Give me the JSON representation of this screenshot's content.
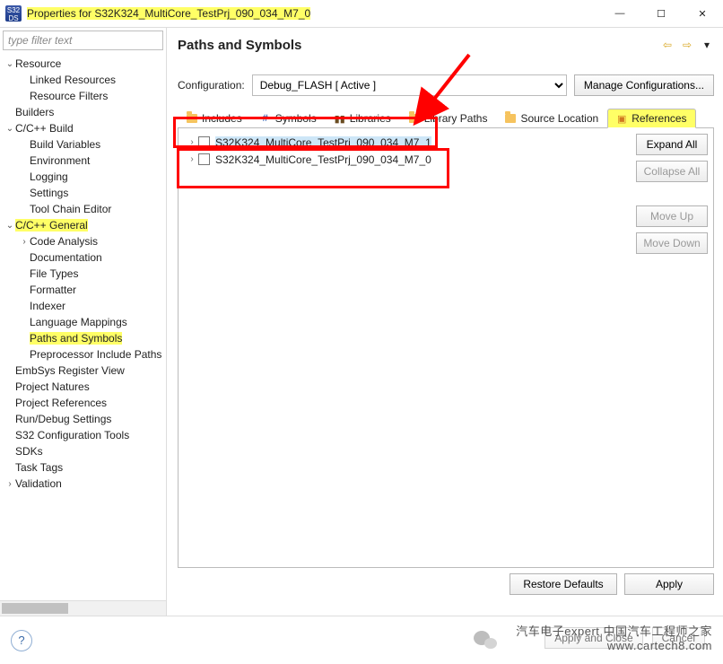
{
  "window": {
    "title": "Properties for S32K324_MultiCore_TestPrj_090_034_M7_0",
    "minimize": "—",
    "maximize": "☐",
    "close": "✕"
  },
  "filter_placeholder": "type filter text",
  "tree": {
    "resource": "Resource",
    "linked_resources": "Linked Resources",
    "resource_filters": "Resource Filters",
    "builders": "Builders",
    "c_build": "C/C++ Build",
    "build_variables": "Build Variables",
    "environment": "Environment",
    "logging": "Logging",
    "settings": "Settings",
    "tool_chain_editor": "Tool Chain Editor",
    "c_general": "C/C++ General",
    "code_analysis": "Code Analysis",
    "documentation": "Documentation",
    "file_types": "File Types",
    "formatter": "Formatter",
    "indexer": "Indexer",
    "language_mappings": "Language Mappings",
    "paths_and_symbols": "Paths and Symbols",
    "preprocessor_include_paths": "Preprocessor Include Paths",
    "embsys": "EmbSys Register View",
    "project_natures": "Project Natures",
    "project_references": "Project References",
    "run_debug": "Run/Debug Settings",
    "s32_config": "S32 Configuration Tools",
    "sdks": "SDKs",
    "task_tags": "Task Tags",
    "validation": "Validation"
  },
  "page": {
    "title": "Paths and Symbols",
    "config_label": "Configuration:",
    "config_value": "Debug_FLASH  [ Active ]",
    "manage_btn": "Manage Configurations..."
  },
  "tabs": {
    "includes": "Includes",
    "symbols": "Symbols",
    "libraries": "Libraries",
    "library_paths": "Library Paths",
    "source_location": "Source Location",
    "references": "References"
  },
  "refs": {
    "items": [
      "S32K324_MultiCore_TestPrj_090_034_M7_1",
      "S32K324_MultiCore_TestPrj_090_034_M7_0"
    ]
  },
  "side_buttons": {
    "expand": "Expand All",
    "collapse": "Collapse All",
    "moveup": "Move Up",
    "movedown": "Move Down"
  },
  "footer": {
    "restore": "Restore Defaults",
    "apply": "Apply",
    "apply_close": "Apply and Close",
    "cancel": "Cancel"
  },
  "watermark": {
    "line1": "汽车电子expert 中国汽车工程师之家",
    "line2": "www.cartech8.com"
  }
}
